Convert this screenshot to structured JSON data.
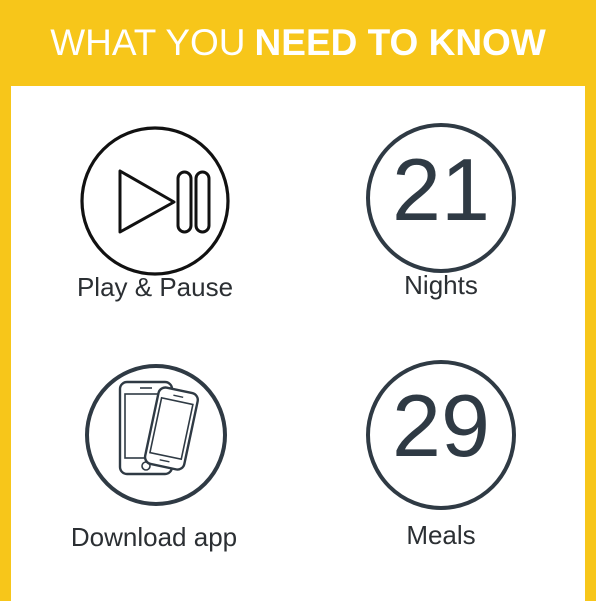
{
  "header": {
    "title_light": "WHAT YOU",
    "title_bold": "NEED TO KNOW"
  },
  "colors": {
    "banner": "#f7c61a",
    "ring": "#2f3a44",
    "text": "#2b2f33"
  },
  "items": [
    {
      "icon": "play-pause-icon",
      "label": "Play & Pause"
    },
    {
      "icon": "number-circle",
      "number": "21",
      "label": "Nights"
    },
    {
      "icon": "phones-icon",
      "label": "Download app"
    },
    {
      "icon": "number-circle",
      "number": "29",
      "label": "Meals"
    }
  ]
}
